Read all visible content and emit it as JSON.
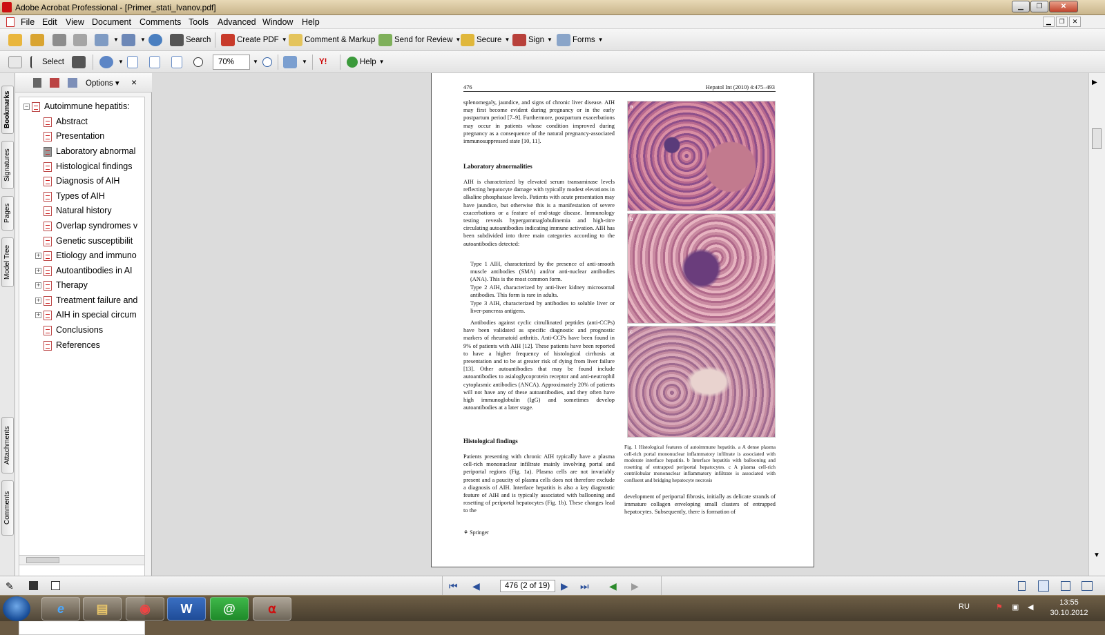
{
  "window": {
    "title": "Adobe Acrobat Professional - [Primer_stati_Ivanov.pdf]"
  },
  "menu": [
    "File",
    "Edit",
    "View",
    "Document",
    "Comments",
    "Tools",
    "Advanced",
    "Window",
    "Help"
  ],
  "toolbar1": {
    "search": "Search",
    "create_pdf": "Create PDF",
    "comment": "Comment & Markup",
    "send": "Send for Review",
    "secure": "Secure",
    "sign": "Sign",
    "forms": "Forms"
  },
  "toolbar2": {
    "select": "Select",
    "zoom": "70%",
    "help": "Help"
  },
  "left_tabs": [
    "Bookmarks",
    "Signatures",
    "Pages",
    "Model Tree",
    "Attachments",
    "Comments"
  ],
  "panel": {
    "options": "Options",
    "close": "×"
  },
  "bookmarks": [
    "Autoimmune hepatitis:",
    "Abstract",
    "Presentation",
    "Laboratory abnormal",
    "Histological findings",
    "Diagnosis of AIH",
    "Types of AIH",
    "Natural history",
    "Overlap syndromes v",
    "Genetic susceptibilit",
    "Etiology and immuno",
    "Autoantibodies in AI",
    "Therapy",
    "Treatment failure and",
    "AIH in special circum",
    "Conclusions",
    "References"
  ],
  "page": {
    "num": "476",
    "journal": "Hepatol Int (2010) 4:475–493",
    "p1": "splenomegaly, jaundice, and signs of chronic liver disease. AIH may first become evident during pregnancy or in the early postpartum period [7–9]. Furthermore, postpartum exacerbations may occur in patients whose condition improved during pregnancy as a consequence of the natural pregnancy-associated immunosuppressed state [10, 11].",
    "h1": "Laboratory abnormalities",
    "p2": "AIH is characterized by elevated serum transaminase levels reflecting hepatocyte damage with typically modest elevations in alkaline phosphatase levels. Patients with acute presentation may have jaundice, but otherwise this is a manifestation of severe exacerbations or a feature of end-stage disease. Immunology testing reveals hypergammaglobulinemia and high-titre circulating autoantibodies indicating immune activation. AIH has been subdivided into three main categories according to the autoantibodies detected:",
    "t1": "Type 1 AIH, characterized by the presence of anti-smooth muscle antibodies (SMA) and/or anti-nuclear antibodies (ANA). This is the most common form.",
    "t2": "Type 2 AIH, characterized by anti-liver kidney microsomal antibodies. This form is rare in adults.",
    "t3": "Type 3 AIH, characterized by antibodies to soluble liver or liver-pancreas antigens.",
    "p3": "Antibodies against cyclic citrullinated peptides (anti-CCPs) have been validated as specific diagnostic and prognostic markers of rheumatoid arthritis. Anti-CCPs have been found in 9% of patients with AIH [12]. These patients have been reported to have a higher frequency of histological cirrhosis at presentation and to be at greater risk of dying from liver failure [13]. Other autoantibodies that may be found include autoantibodies to asialoglycoprotein receptor and anti-neutrophil cytoplasmic antibodies (ANCA). Approximately 20% of patients will not have any of these autoantibodies, and they often have high immunoglobulin (IgG) and sometimes develop autoantibodies at a later stage.",
    "h2": "Histological findings",
    "p4": "Patients presenting with chronic AIH typically have a plasma cell-rich mononuclear infiltrate mainly involving portal and periportal regions (Fig. 1a). Plasma cells are not invariably present and a paucity of plasma cells does not therefore exclude a diagnosis of AIH. Interface hepatitis is also a key diagnostic feature of AIH and is typically associated with ballooning and rosetting of periportal hepatocytes (Fig. 1b). These changes lead to the",
    "caption": "Fig. 1 Histological features of autoimmune hepatitis. a A dense plasma cell-rich portal mononuclear inflammatory infiltrate is associated with moderate interface hepatitis. b Interface hepatitis with ballooning and rosetting of entrapped periportal hepatocytes. c A plasma cell-rich centrilobular mononuclear inflammatory infiltrate is associated with confluent and bridging hepatocyte necrosis",
    "p5": "development of periportal fibrosis, initially as delicate strands of immature collagen enveloping small clusters of entrapped hepatocytes. Subsequently, there is formation of",
    "fig_a": "a",
    "fig_b": "b",
    "fig_c": "c",
    "springer": "Springer"
  },
  "status": {
    "page_box": "476  (2 of 19)"
  },
  "taskbar": {
    "lang": "RU",
    "time": "13:55",
    "date": "30.10.2012",
    "word": "W",
    "mail": "@"
  }
}
